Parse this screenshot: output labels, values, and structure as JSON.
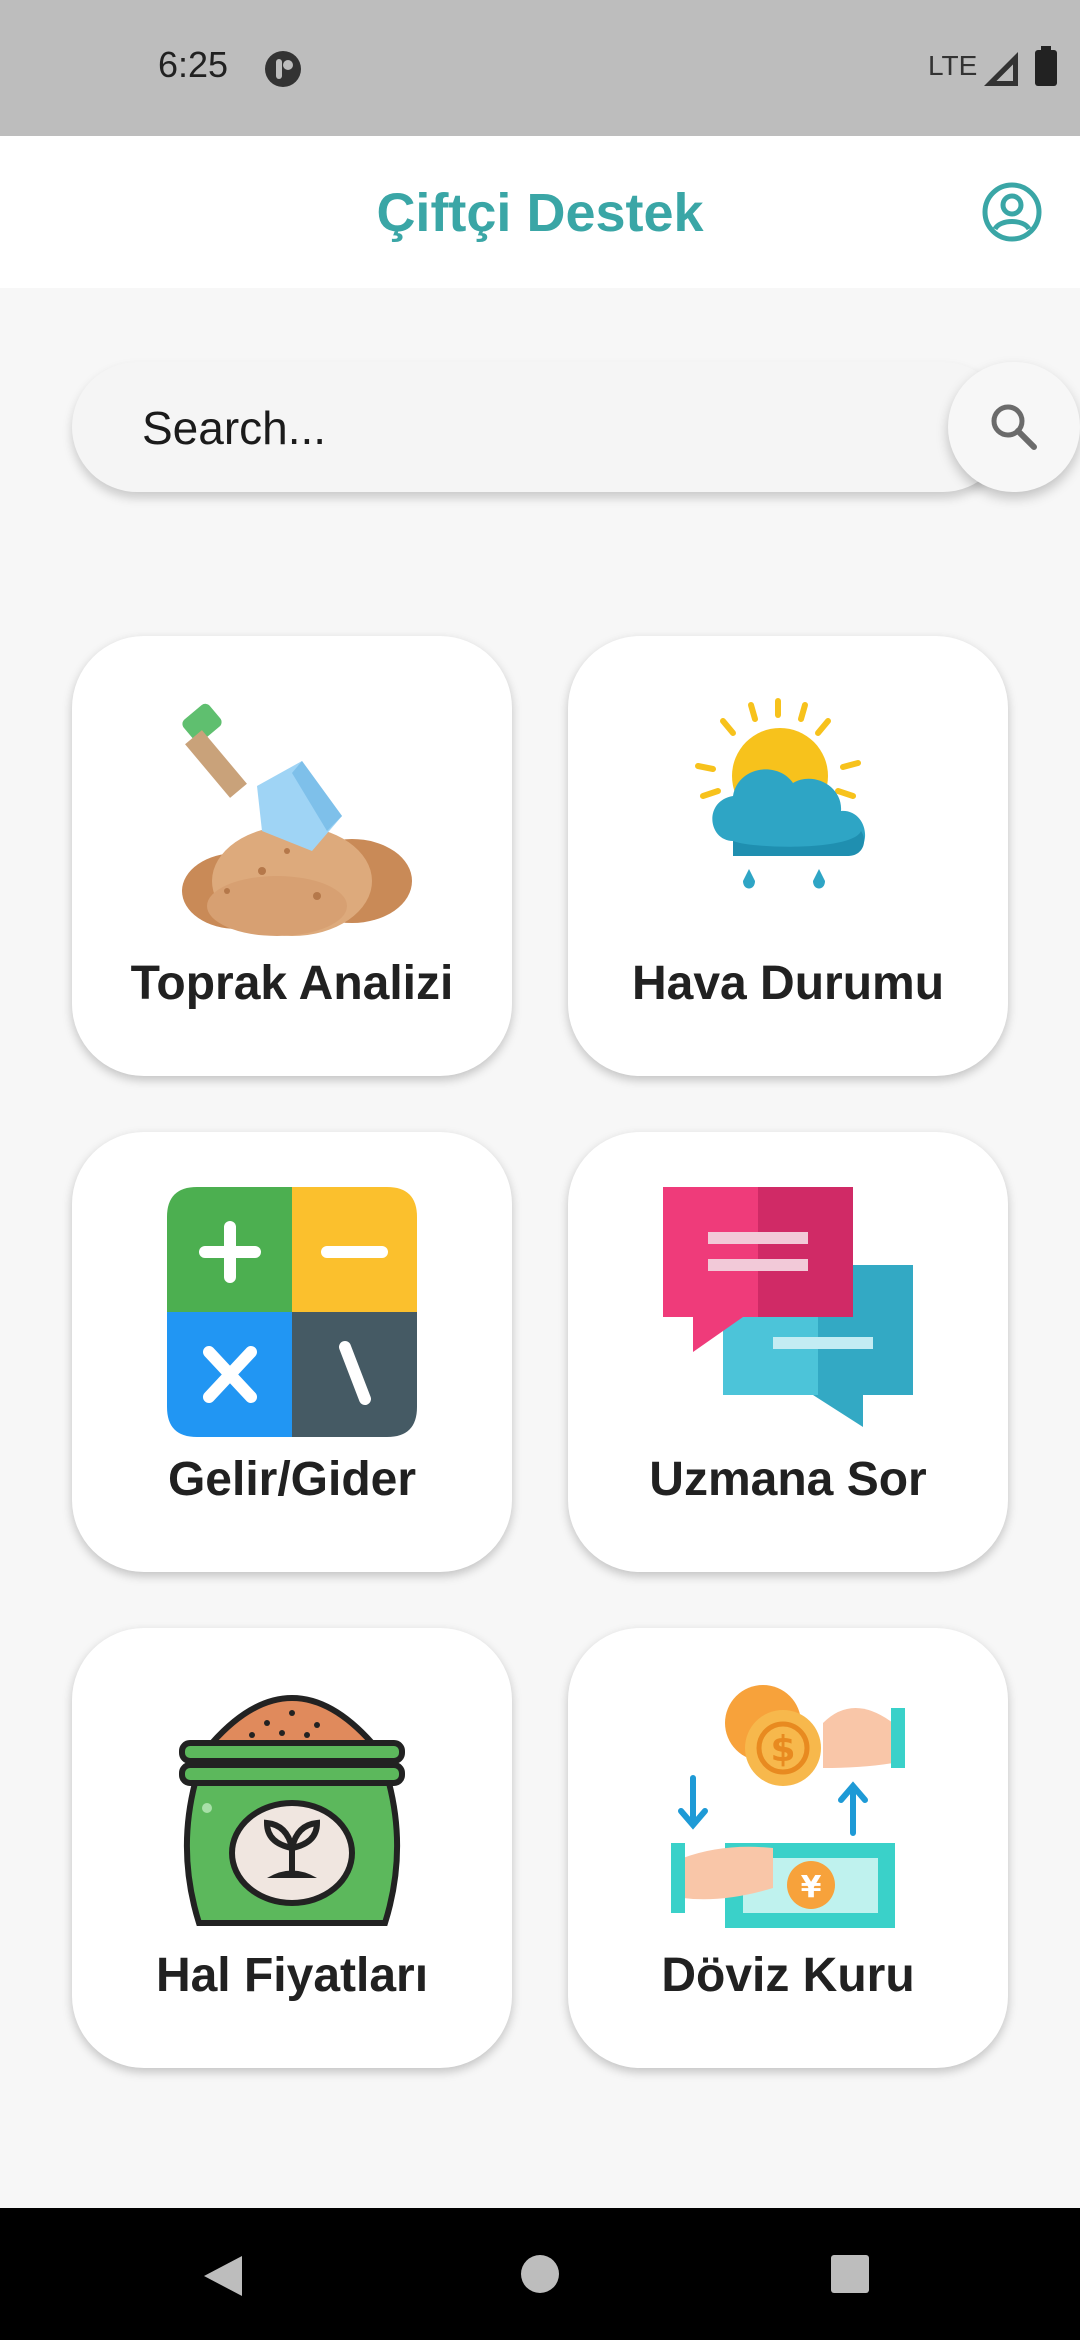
{
  "status_bar": {
    "time": "6:25",
    "network": "LTE",
    "icons": [
      "app-notification-icon",
      "signal-icon",
      "battery-icon"
    ]
  },
  "app_bar": {
    "title": "Çiftçi Destek",
    "title_color": "#3aa6a6",
    "profile_icon": "account-circle-icon"
  },
  "search": {
    "placeholder": "Search...",
    "button_icon": "search-icon"
  },
  "tiles": [
    {
      "label": "Toprak Analizi",
      "icon": "soil-shovel-icon"
    },
    {
      "label": "Hava Durumu",
      "icon": "weather-sun-cloud-icon"
    },
    {
      "label": "Gelir/Gider",
      "icon": "calculator-icon"
    },
    {
      "label": "Uzmana Sor",
      "icon": "chat-bubbles-icon"
    },
    {
      "label": "Hal Fiyatları",
      "icon": "seed-sack-icon"
    },
    {
      "label": "Döviz Kuru",
      "icon": "currency-exchange-icon"
    }
  ],
  "nav_bar": {
    "buttons": [
      "back-icon",
      "home-icon",
      "recents-icon"
    ]
  },
  "colors": {
    "accent": "#3aa6a6",
    "background": "#f7f7f7",
    "status_bar": "#bdbdbd"
  }
}
